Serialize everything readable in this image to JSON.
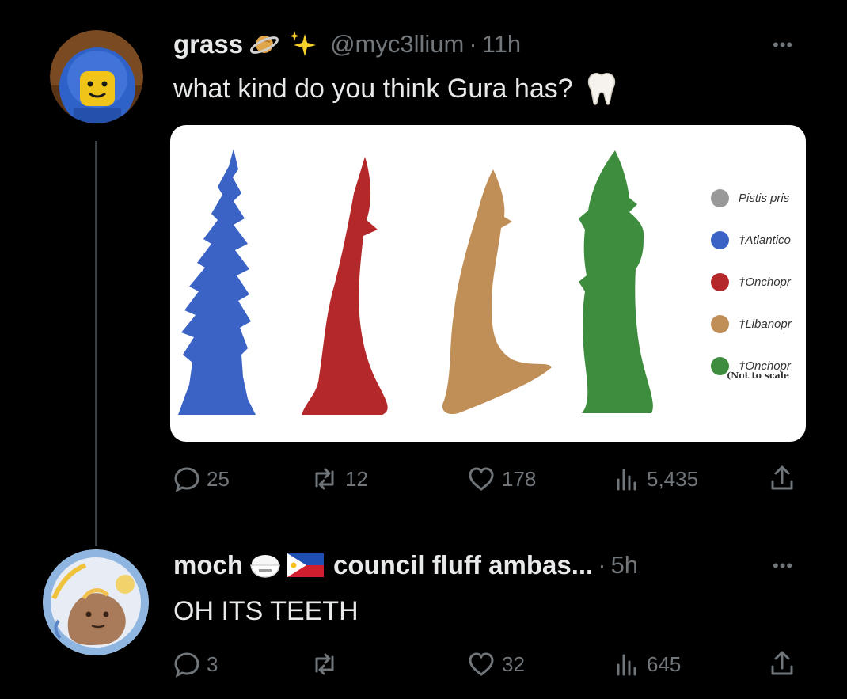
{
  "tweet1": {
    "name": "grass",
    "handle": "@myc3llium",
    "separator": "·",
    "time": "11h",
    "text": "what kind do you think Gura has?",
    "more": "•••",
    "stats": {
      "replies": "25",
      "retweets": "12",
      "likes": "178",
      "views": "5,435"
    }
  },
  "image": {
    "legend": [
      {
        "label": "Pistis pris",
        "color": "#999999"
      },
      {
        "label": "†Atlantico",
        "color": "#3b62c5"
      },
      {
        "label": "†Onchopr",
        "color": "#b5282a"
      },
      {
        "label": "†Libanopr",
        "color": "#c08e57"
      },
      {
        "label": "†Onchopr",
        "color": "#3e8d3e"
      }
    ],
    "note": "(Not to scale"
  },
  "tweet2": {
    "name": "moch",
    "display_suffix": "council fluff ambas...",
    "separator": "·",
    "time": "5h",
    "text": "OH ITS TEETH",
    "more": "•••",
    "stats": {
      "replies": "3",
      "retweets": "",
      "likes": "32",
      "views": "645"
    }
  }
}
